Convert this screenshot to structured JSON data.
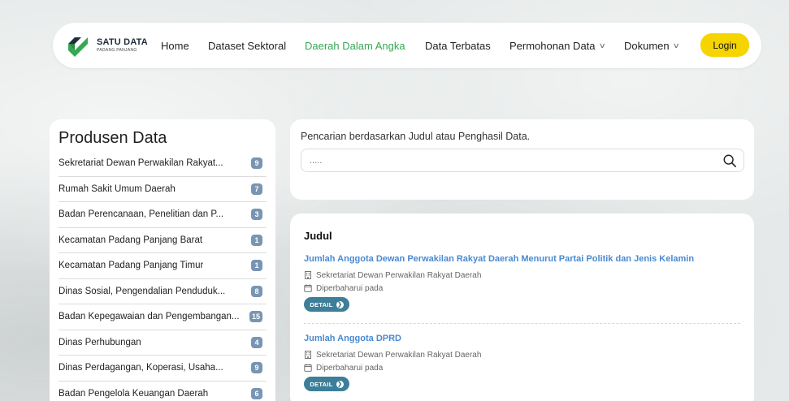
{
  "brand": {
    "title": "SATU DATA",
    "subtitle": "PADANG PANJANG",
    "colors": {
      "dark": "#1f2d3d",
      "green": "#35a853"
    }
  },
  "nav": {
    "items": [
      {
        "label": "Home",
        "active": false,
        "dropdown": false
      },
      {
        "label": "Dataset Sektoral",
        "active": false,
        "dropdown": false
      },
      {
        "label": "Daerah Dalam Angka",
        "active": true,
        "dropdown": false
      },
      {
        "label": "Data Terbatas",
        "active": false,
        "dropdown": false
      },
      {
        "label": "Permohonan Data",
        "active": false,
        "dropdown": true
      },
      {
        "label": "Dokumen",
        "active": false,
        "dropdown": true
      }
    ],
    "login_label": "Login",
    "accent_color": "#35a853",
    "login_color": "#f5d400"
  },
  "producers": {
    "title": "Produsen Data",
    "items": [
      {
        "name": "Sekretariat Dewan Perwakilan Rakyat...",
        "count": "9"
      },
      {
        "name": "Rumah Sakit Umum Daerah",
        "count": "7"
      },
      {
        "name": "Badan Perencanaan, Penelitian dan P...",
        "count": "3"
      },
      {
        "name": "Kecamatan Padang Panjang Barat",
        "count": "1"
      },
      {
        "name": "Kecamatan Padang Panjang Timur",
        "count": "1"
      },
      {
        "name": "Dinas Sosial, Pengendalian Penduduk...",
        "count": "8"
      },
      {
        "name": "Badan Kepegawaian dan Pengembangan...",
        "count": "15"
      },
      {
        "name": "Dinas Perhubungan",
        "count": "4"
      },
      {
        "name": "Dinas Perdagangan, Koperasi, Usaha...",
        "count": "9"
      },
      {
        "name": "Badan Pengelola Keuangan Daerah",
        "count": "6"
      }
    ]
  },
  "search": {
    "label": "Pencarian berdasarkan Judul atau Penghasil Data.",
    "placeholder": ".....",
    "value": ""
  },
  "results": {
    "header": "Judul",
    "items": [
      {
        "title": "Jumlah Anggota Dewan Perwakilan Rakyat Daerah Menurut Partai Politik dan Jenis Kelamin",
        "producer": "Sekretariat Dewan Perwakilan Rakyat Daerah",
        "updated": "Diperbaharui pada",
        "button": "DETAIL"
      },
      {
        "title": "Jumlah Anggota DPRD",
        "producer": "Sekretariat Dewan Perwakilan Rakyat Daerah",
        "updated": "Diperbaharui pada",
        "button": "DETAIL"
      }
    ]
  }
}
